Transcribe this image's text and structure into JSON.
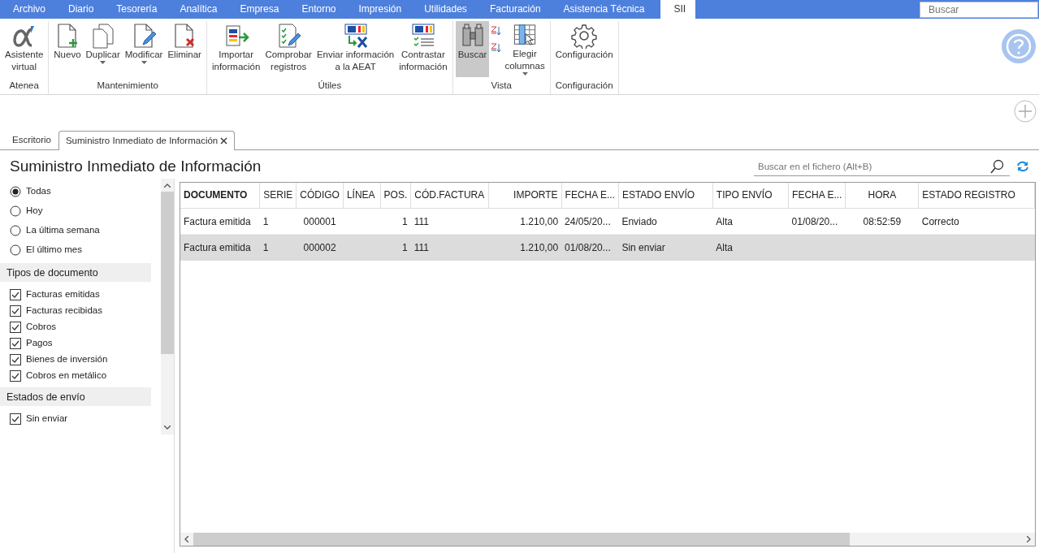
{
  "menu": [
    {
      "label": "Archivo",
      "selected": false
    },
    {
      "label": "Diario",
      "selected": false
    },
    {
      "label": "Tesorería",
      "selected": false
    },
    {
      "label": "Analítica",
      "selected": false
    },
    {
      "label": "Empresa",
      "selected": false
    },
    {
      "label": "Entorno",
      "selected": false
    },
    {
      "label": "Impresión",
      "selected": false
    },
    {
      "label": "Utilidades",
      "selected": false
    },
    {
      "label": "Facturación",
      "selected": false
    },
    {
      "label": "Asistencia Técnica",
      "selected": false
    },
    {
      "label": "SII",
      "selected": true
    }
  ],
  "top_search": {
    "placeholder": "Buscar"
  },
  "ribbon": [
    {
      "label": "Atenea",
      "buttons": [
        {
          "kind": "large",
          "label": "Asistente\nvirtual",
          "dropdown": false,
          "selected": false
        }
      ]
    },
    {
      "label": "Mantenimiento",
      "buttons": [
        {
          "kind": "large",
          "label": "Nuevo",
          "dropdown": false,
          "selected": false
        },
        {
          "kind": "large",
          "label": "Duplicar",
          "dropdown": true,
          "selected": false
        },
        {
          "kind": "large",
          "label": "Modificar",
          "dropdown": true,
          "selected": false
        },
        {
          "kind": "large",
          "label": "Eliminar",
          "dropdown": false,
          "selected": false
        }
      ]
    },
    {
      "label": "Útiles",
      "buttons": [
        {
          "kind": "large",
          "label": "Importar\ninformación",
          "dropdown": false,
          "selected": false
        },
        {
          "kind": "large",
          "label": "Comprobar\nregistros",
          "dropdown": false,
          "selected": false
        },
        {
          "kind": "large",
          "label": "Enviar información\na la AEAT",
          "dropdown": false,
          "selected": false
        },
        {
          "kind": "large",
          "label": "Contrastar\ninformación",
          "dropdown": false,
          "selected": false
        }
      ]
    },
    {
      "label": "Vista",
      "buttons": [
        {
          "kind": "large",
          "label": "Buscar",
          "dropdown": false,
          "selected": true
        },
        {
          "kind": "stack"
        },
        {
          "kind": "large",
          "label": "Elegir\ncolumnas",
          "dropdown": true,
          "selected": false
        }
      ]
    },
    {
      "label": "Configuración",
      "buttons": [
        {
          "kind": "large",
          "label": "Configuración",
          "dropdown": false,
          "selected": false
        }
      ]
    }
  ],
  "tabs": [
    {
      "label": "Escritorio",
      "selected": false,
      "closable": false
    },
    {
      "label": "Suministro Inmediato de Información",
      "selected": true,
      "closable": true
    }
  ],
  "page_title": "Suministro Inmediato de Información",
  "file_search": {
    "placeholder": "Buscar en el fichero (Alt+B)"
  },
  "periods": [
    {
      "label": "Todas",
      "selected": true
    },
    {
      "label": "Hoy",
      "selected": false
    },
    {
      "label": "La última semana",
      "selected": false
    },
    {
      "label": "El último mes",
      "selected": false
    }
  ],
  "filter_sections": [
    {
      "title": "Tipos de documento",
      "items": [
        {
          "label": "Facturas emitidas",
          "checked": true
        },
        {
          "label": "Facturas recibidas",
          "checked": true
        },
        {
          "label": "Cobros",
          "checked": true
        },
        {
          "label": "Pagos",
          "checked": true
        },
        {
          "label": "Bienes de inversión",
          "checked": true
        },
        {
          "label": "Cobros en metálico",
          "checked": true
        }
      ]
    },
    {
      "title": "Estados de envío",
      "items": [
        {
          "label": "Sin enviar",
          "checked": true
        }
      ]
    }
  ],
  "table": {
    "columns": [
      {
        "label": "DOCUMENTO",
        "sorted": true
      },
      {
        "label": "SERIE",
        "sorted": false
      },
      {
        "label": "CÓDIGO",
        "sorted": false
      },
      {
        "label": "LÍNEA",
        "sorted": false
      },
      {
        "label": "POS.",
        "sorted": false
      },
      {
        "label": "CÓD.FACTURA",
        "sorted": false
      },
      {
        "label": "IMPORTE",
        "sorted": false
      },
      {
        "label": "FECHA E...",
        "sorted": false
      },
      {
        "label": "ESTADO ENVÍO",
        "sorted": false
      },
      {
        "label": "TIPO ENVÍO",
        "sorted": false
      },
      {
        "label": "FECHA E...",
        "sorted": false
      },
      {
        "label": "HORA",
        "sorted": false
      },
      {
        "label": "ESTADO REGISTRO",
        "sorted": false
      }
    ],
    "rows": [
      {
        "selected": false,
        "cells": [
          "Factura emitida",
          "1",
          "000001",
          null,
          "1",
          "111",
          "1.210,00",
          "24/05/20...",
          "Enviado",
          "Alta",
          "01/08/20...",
          "08:52:59",
          "Correcto"
        ]
      },
      {
        "selected": true,
        "cells": [
          "Factura emitida",
          "1",
          "000002",
          null,
          "1",
          "111",
          "1.210,00",
          "01/08/20...",
          "Sin enviar",
          "Alta",
          null,
          null,
          null
        ]
      }
    ]
  }
}
